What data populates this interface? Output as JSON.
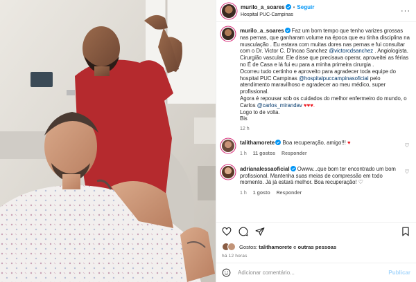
{
  "header": {
    "username": "murilo_a_soares",
    "separator": "•",
    "follow_label": "Seguir",
    "location": "Hospital PUC-Campinas",
    "more_icon": "more-horizontal-icon"
  },
  "caption": {
    "username": "murilo_a_soares",
    "l1": "Faz um bom tempo que tenho varizes grossas nas pernas, que ganharam volume na época que eu tinha disciplina na musculação . Eu estava com muitas dores nas pernas e fui consultar com o Dr. Victor C. D'Incao Sanchez",
    "m1": "@victorcdsanchez",
    "l2": ". Angiologista. Cirurgião vascular. Ele disse que precisava operar, aproveitei as férias no É de Casa e lá fui eu para a minha primeira cirurgia .",
    "l3": "Ocorreu tudo certinho e aproveito para agradecer toda equipe do hospital PUC Campinas",
    "m2": "@hospitalpuccampinasoficial",
    "l4": "pelo atendimento maravilhoso e agradecer ao meu médico, super profissional.",
    "l5": "Agora é repousar sob os cuidados do melhor enfermeiro do mundo, o Carlos",
    "m3": "@carlos_mirandav",
    "hearts": "♥♥♥.",
    "l6": "Logo to de volta.",
    "l7": "Bis",
    "time": "12 h"
  },
  "comments": [
    {
      "username": "talithamorete",
      "text": "Boa recuperação, amigo!!!",
      "emoji": "♥",
      "time": "1 h",
      "likes": "11 gostos",
      "reply": "Responder"
    },
    {
      "username": "adrianalessaoficial",
      "text": "Owww...que bom ter encontrado um bom profissional. Mantenha suas meias de compressão em todo momento. Já já estará melhor. Boa recuperação!",
      "emoji": "♡",
      "time": "1 h",
      "likes": "1 gosto",
      "reply": "Responder"
    }
  ],
  "likes": {
    "prefix": "Gostos:",
    "first": "talithamorete",
    "connector": "e",
    "rest": "outras pessoas"
  },
  "post_age": "há 12 horas",
  "composer": {
    "placeholder": "Adicionar comentário...",
    "post_label": "Publicar"
  },
  "colors": {
    "accent": "#0095f6",
    "mention": "#00376b",
    "muted": "#737373",
    "heart": "#ed1c24"
  }
}
